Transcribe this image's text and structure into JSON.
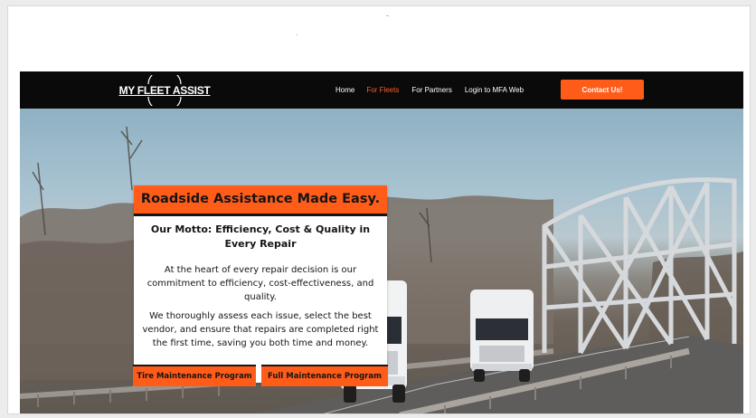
{
  "brand": {
    "logo_text": "MY FLEET ASSIST"
  },
  "nav": {
    "links": [
      {
        "label": "Home",
        "active": false
      },
      {
        "label": "For Fleets",
        "active": true
      },
      {
        "label": "For Partners",
        "active": false
      },
      {
        "label": "Login to MFA Web",
        "active": false
      }
    ],
    "cta_label": "Contact Us!"
  },
  "hero": {
    "title": "Roadside Assistance Made Easy.",
    "heading": "Our Motto: Efficiency, Cost & Quality in Every Repair",
    "paragraph1": "At the heart of every repair decision is our commitment to efficiency, cost-effectiveness, and quality.",
    "paragraph2": "We thoroughly assess each issue, select the best vendor, and ensure that repairs are completed right the first time, saving you both time and money.",
    "buttons": [
      {
        "label": "Tire Maintenance Program"
      },
      {
        "label": "Full Maintenance Program"
      }
    ]
  },
  "colors": {
    "accent": "#ff5c1a",
    "active_link": "#ff5e1a",
    "navbar": "#0a0a0a"
  },
  "icons": [
    "logo-mark"
  ]
}
